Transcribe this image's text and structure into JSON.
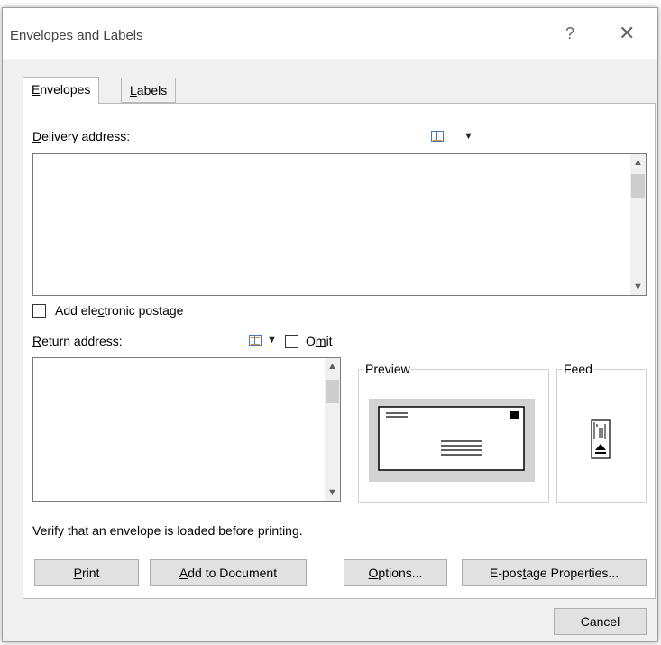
{
  "window": {
    "title": "Envelopes and Labels",
    "help_glyph": "?",
    "close_glyph": "✕"
  },
  "tabs": [
    {
      "label": "Envelopes",
      "accel": "E",
      "rest": "nvelopes",
      "active": true
    },
    {
      "label": "Labels",
      "accel": "L",
      "rest": "abels",
      "active": false
    }
  ],
  "delivery": {
    "label": "Delivery address:",
    "accel": "D",
    "rest": "elivery address:",
    "value": ""
  },
  "postage": {
    "label": "Add electronic postage",
    "pre": "Add ele",
    "accel": "c",
    "post": "tronic postage",
    "checked": false
  },
  "return": {
    "label": "Return address:",
    "accel": "R",
    "rest": "eturn address:",
    "value": ""
  },
  "omit": {
    "label": "Omit",
    "pre": "O",
    "accel": "m",
    "post": "it",
    "checked": false
  },
  "preview": {
    "label": "Preview"
  },
  "feed": {
    "label": "Feed"
  },
  "verify_text": "Verify that an envelope is loaded before printing.",
  "buttons": {
    "print": {
      "label": "Print",
      "accel": "P",
      "rest": "rint"
    },
    "add_to_document": {
      "label": "Add to Document",
      "accel": "A",
      "rest": "dd to Document"
    },
    "options": {
      "label": "Options...",
      "accel": "O",
      "rest": "ptions..."
    },
    "epostage": {
      "label": "E-postage Properties...",
      "pre": "E-pos",
      "accel": "t",
      "post": "age Properties..."
    },
    "cancel": {
      "label": "Cancel"
    }
  },
  "icons": {
    "address_book": "address-book-icon",
    "dropdown": "▼",
    "scroll_up": "▲",
    "scroll_down": "▼"
  }
}
